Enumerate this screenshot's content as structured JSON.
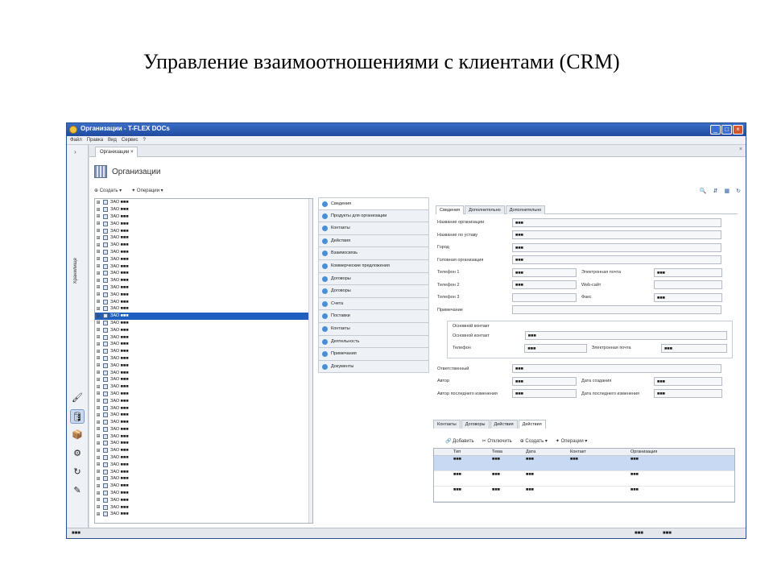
{
  "slide_title": "Управление взаимоотношениями с клиентами (CRM)",
  "window": {
    "title": "Организации - T-FLEX DOCs"
  },
  "menu": [
    "Файл",
    "Правка",
    "Вид",
    "Сервис",
    "?"
  ],
  "sidebar": {
    "label": "Хранилище"
  },
  "doc_tab": {
    "label": "Организации"
  },
  "page_title": "Организации",
  "toolbar": {
    "create": "Создать",
    "operations": "Операции"
  },
  "tree": {
    "items": [
      "ЗАО ■■■",
      "ЗАО ■■■",
      "ЗАО ■■■",
      "ЗАО ■■■",
      "ЗАО ■■■",
      "ЗАО ■■■",
      "ЗАО ■■■",
      "ЗАО ■■■",
      "ЗАО ■■■",
      "ЗАО ■■■",
      "ЗАО ■■■",
      "ЗАО ■■■",
      "ЗАО ■■■",
      "ЗАО ■■■",
      "ЗАО ■■■",
      "ЗАО ■■■",
      "ЗАО ■■■",
      "ЗАО ■■■",
      "ЗАО ■■■",
      "ЗАО ■■■",
      "ЗАО ■■■",
      "ЗАО ■■■",
      "ЗАО ■■■",
      "ЗАО ■■■",
      "ЗАО ■■■",
      "ЗАО ■■■",
      "ЗАО ■■■",
      "ЗАО ■■■",
      "ЗАО ■■■",
      "ЗАО ■■■",
      "ЗАО ■■■",
      "ЗАО ■■■",
      "ЗАО ■■■",
      "ЗАО ■■■",
      "ЗАО ■■■",
      "ЗАО ■■■",
      "ЗАО ■■■",
      "ЗАО ■■■",
      "ЗАО ■■■",
      "ЗАО ■■■",
      "ЗАО ■■■",
      "ЗАО ■■■",
      "ЗАО ■■■",
      "ЗАО ■■■",
      "ЗАО ■■■"
    ],
    "selected_index": 16
  },
  "sections": [
    "Сведения",
    "Продукты для организации",
    "Контакты",
    "Действия",
    "Взаимосвязь",
    "Коммерческие предложения",
    "Договоры",
    "Договоры",
    "Счета",
    "Поставки",
    "Контакты",
    "Деятельность",
    "Примечания",
    "Документы"
  ],
  "detail_tabs": [
    "Сведения",
    "Дополнительно",
    "Дополнительно"
  ],
  "form": {
    "rows": [
      {
        "label": "Название организации",
        "value": "■■■"
      },
      {
        "label": "Название по уставу",
        "value": "■■■"
      },
      {
        "label": "Город",
        "value": "■■■"
      },
      {
        "label": "Головная организация",
        "value": "■■■"
      },
      {
        "label": "Телефон 1",
        "value": "■■■",
        "label2": "Электронная почта",
        "value2": "■■■"
      },
      {
        "label": "Телефон 2",
        "value": "■■■",
        "label2": "Web-сайт",
        "value2": ""
      },
      {
        "label": "Телефон 3",
        "value": "",
        "label2": "Факс",
        "value2": "■■■"
      },
      {
        "label": "Примечание",
        "value": ""
      }
    ],
    "contact": {
      "legend": "Основной контакт",
      "rows": [
        {
          "label": "Основной контакт",
          "value": "■■■"
        },
        {
          "label": "Телефон",
          "value": "■■■",
          "label2": "Электронная почта",
          "value2": "■■■"
        }
      ]
    },
    "bottom_rows": [
      {
        "label": "Ответственный",
        "value": "■■■"
      },
      {
        "label": "Автор",
        "value": "■■■",
        "label2": "Дата создания",
        "value2": "■■■"
      },
      {
        "label": "Автор последнего изменения",
        "value": "■■■",
        "label2": "Дата последнего изменения",
        "value2": "■■■"
      }
    ]
  },
  "bottom_tabs": [
    "Контакты",
    "Договоры",
    "Действия",
    "Действия"
  ],
  "bottom_toolbar": {
    "add": "Добавить",
    "remove": "Отключить",
    "create": "Создать",
    "operations": "Операции"
  },
  "grid": {
    "columns": [
      "",
      "Тип",
      "Тема",
      "Дата",
      "Контакт",
      "Организация",
      ""
    ],
    "rows": [
      [
        "",
        "■■■",
        "■■■",
        "■■■",
        "■■■",
        "■■■",
        ""
      ],
      [
        "",
        "■■■",
        "■■■",
        "■■■",
        "",
        "■■■",
        ""
      ],
      [
        "",
        "■■■",
        "■■■",
        "■■■",
        "",
        "■■■",
        ""
      ]
    ]
  },
  "status": {
    "left": "■■■",
    "mid": "■■■",
    "right": "■■■"
  }
}
